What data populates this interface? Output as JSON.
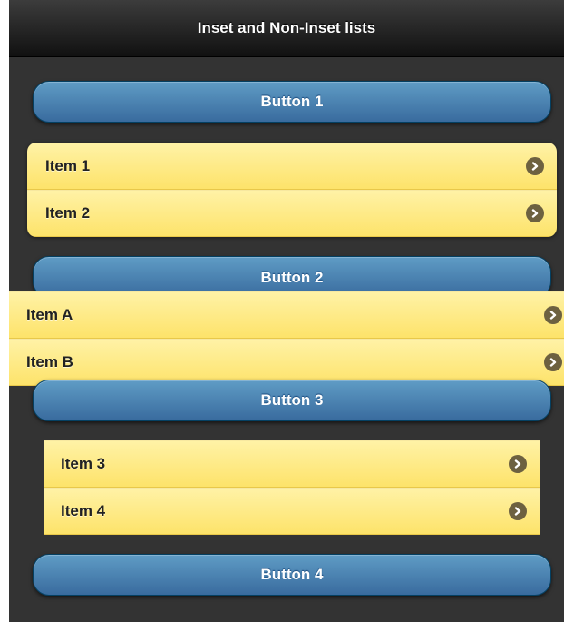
{
  "header": {
    "title": "Inset and Non-Inset lists"
  },
  "buttons": [
    {
      "label": "Button 1"
    },
    {
      "label": "Button 2"
    },
    {
      "label": "Button 3"
    },
    {
      "label": "Button 4"
    }
  ],
  "lists": [
    {
      "style": "inset-rounded",
      "items": [
        {
          "label": "Item 1"
        },
        {
          "label": "Item 2"
        }
      ]
    },
    {
      "style": "non-inset",
      "items": [
        {
          "label": "Item A"
        },
        {
          "label": "Item B"
        }
      ]
    },
    {
      "style": "inset-square",
      "items": [
        {
          "label": "Item 3"
        },
        {
          "label": "Item 4"
        }
      ]
    }
  ],
  "icons": {
    "item_arrow": "chevron-right-circle-icon"
  },
  "colors": {
    "header": "#1a1a1a",
    "page_background": "#333333",
    "button": "#4a82b4",
    "list_item": "#fde98a",
    "arrow_badge": "#6d6140"
  }
}
